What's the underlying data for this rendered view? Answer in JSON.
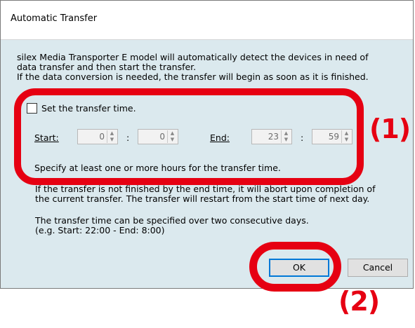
{
  "dialog": {
    "title": "Automatic Transfer",
    "intro_line1": "silex Media Transporter E model will automatically detect the devices in need of",
    "intro_line2": "data transfer and then start the transfer.",
    "intro_line3": "If the data conversion is needed, the transfer will begin as soon as it is finished.",
    "checkbox_label": "Set the transfer time.",
    "checkbox_checked": false,
    "start_label": "Start:",
    "start_hour": "0",
    "start_minute": "0",
    "end_label": "End:",
    "end_hour": "23",
    "end_minute": "59",
    "time_separator": ":",
    "hint": "Specify at least one or more hours for the transfer time.",
    "note_line1": "If the transfer is not finished by the end time, it will abort upon completion of",
    "note_line2": "the current transfer. The transfer will restart from the start time of next day.",
    "days_line1": "The transfer time can be specified over two consecutive days.",
    "days_line2": "(e.g. Start: 22:00 - End: 8:00)",
    "ok_label": "OK",
    "cancel_label": "Cancel"
  },
  "annotations": {
    "callout1": "(1)",
    "callout2": "(2)",
    "highlight_color": "#e60012"
  },
  "icons": {
    "spinner": "up-down-arrows-icon"
  }
}
